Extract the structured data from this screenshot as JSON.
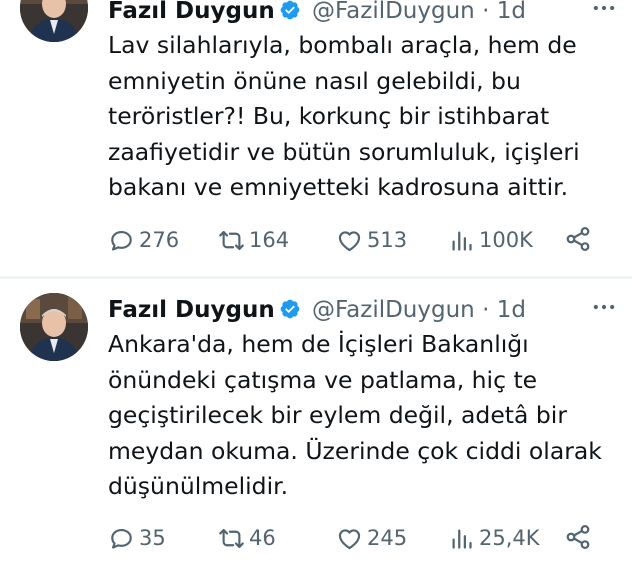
{
  "tweets": [
    {
      "name": "Fazıl Duygun",
      "handle": "@FazilDuygun",
      "separator": "·",
      "time": "1d",
      "text_lines": [
        "Lav silahlarıyla, bombalı araçla, hem de",
        "emniyetin önüne nasıl gelebildi, bu",
        "teröristler?! Bu, korkunç bir istihbarat",
        "zaafiyetidir ve bütün sorumluluk, içişleri",
        "bakanı ve emniyetteki kadrosuna aittir."
      ],
      "replies": "276",
      "retweets": "164",
      "likes": "513",
      "views": "100K"
    },
    {
      "name": "Fazıl Duygun",
      "handle": "@FazilDuygun",
      "separator": "·",
      "time": "1d",
      "text_lines": [
        "Ankara'da, hem de İçişleri Bakanlığı",
        "önündeki çatışma ve patlama, hiç te",
        "geçiştirilecek bir eylem değil, adetâ bir",
        "meydan okuma. Üzerinde çok ciddi olarak",
        "düşünülmelidir."
      ],
      "replies": "35",
      "retweets": "46",
      "likes": "245",
      "views": "25,4K"
    }
  ],
  "icons": [
    "verified-badge-icon",
    "more-options-icon",
    "reply-icon",
    "retweet-icon",
    "like-icon",
    "views-icon",
    "share-icon"
  ],
  "colors": {
    "text": "#0f1419",
    "secondary": "#536471",
    "verified": "#1d9bf0",
    "divider": "#eff3f4"
  }
}
